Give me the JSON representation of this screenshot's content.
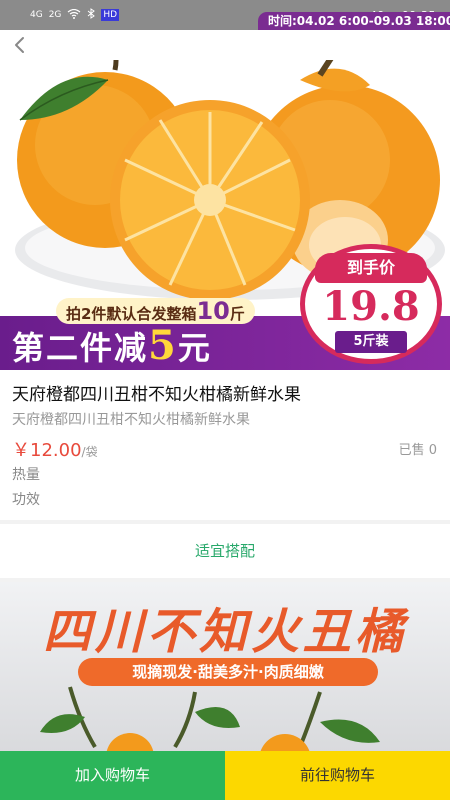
{
  "status_bar": {
    "left_signals": [
      "4G",
      "2G"
    ],
    "badge": "HD",
    "right": "49 ◢ 09:35"
  },
  "hero": {
    "time_banner": "时间:04.02 6:00-09.03 18:00",
    "promo_sub_prefix": "拍2件默认合发整箱",
    "promo_sub_number": "10",
    "promo_sub_suffix": "斤",
    "promo_main_prefix": "第二件减",
    "promo_main_number": "5",
    "promo_main_suffix": "元",
    "price_label": "到手价",
    "price_value": "19.8",
    "price_unit": "5斤装"
  },
  "product": {
    "title": "天府橙都四川丑柑不知火柑橘新鲜水果",
    "subtitle": "天府橙都四川丑柑不知火柑橘新鲜水果",
    "price": "￥12.00",
    "unit": "/袋",
    "sold": "已售 0",
    "attrs": [
      "热量",
      "功效"
    ]
  },
  "suit": {
    "label": "适宜搭配"
  },
  "detail": {
    "title": "四川不知火丑橘",
    "pill": "现摘现发·甜美多汁·肉质细嫩"
  },
  "actions": {
    "add_to_cart": "加入购物车",
    "go_to_cart": "前往购物车"
  },
  "colors": {
    "accent_green": "#2cb55a",
    "accent_yellow": "#fcd800",
    "price_red": "#e84a3c",
    "promo_purple": "#7a2c91"
  }
}
